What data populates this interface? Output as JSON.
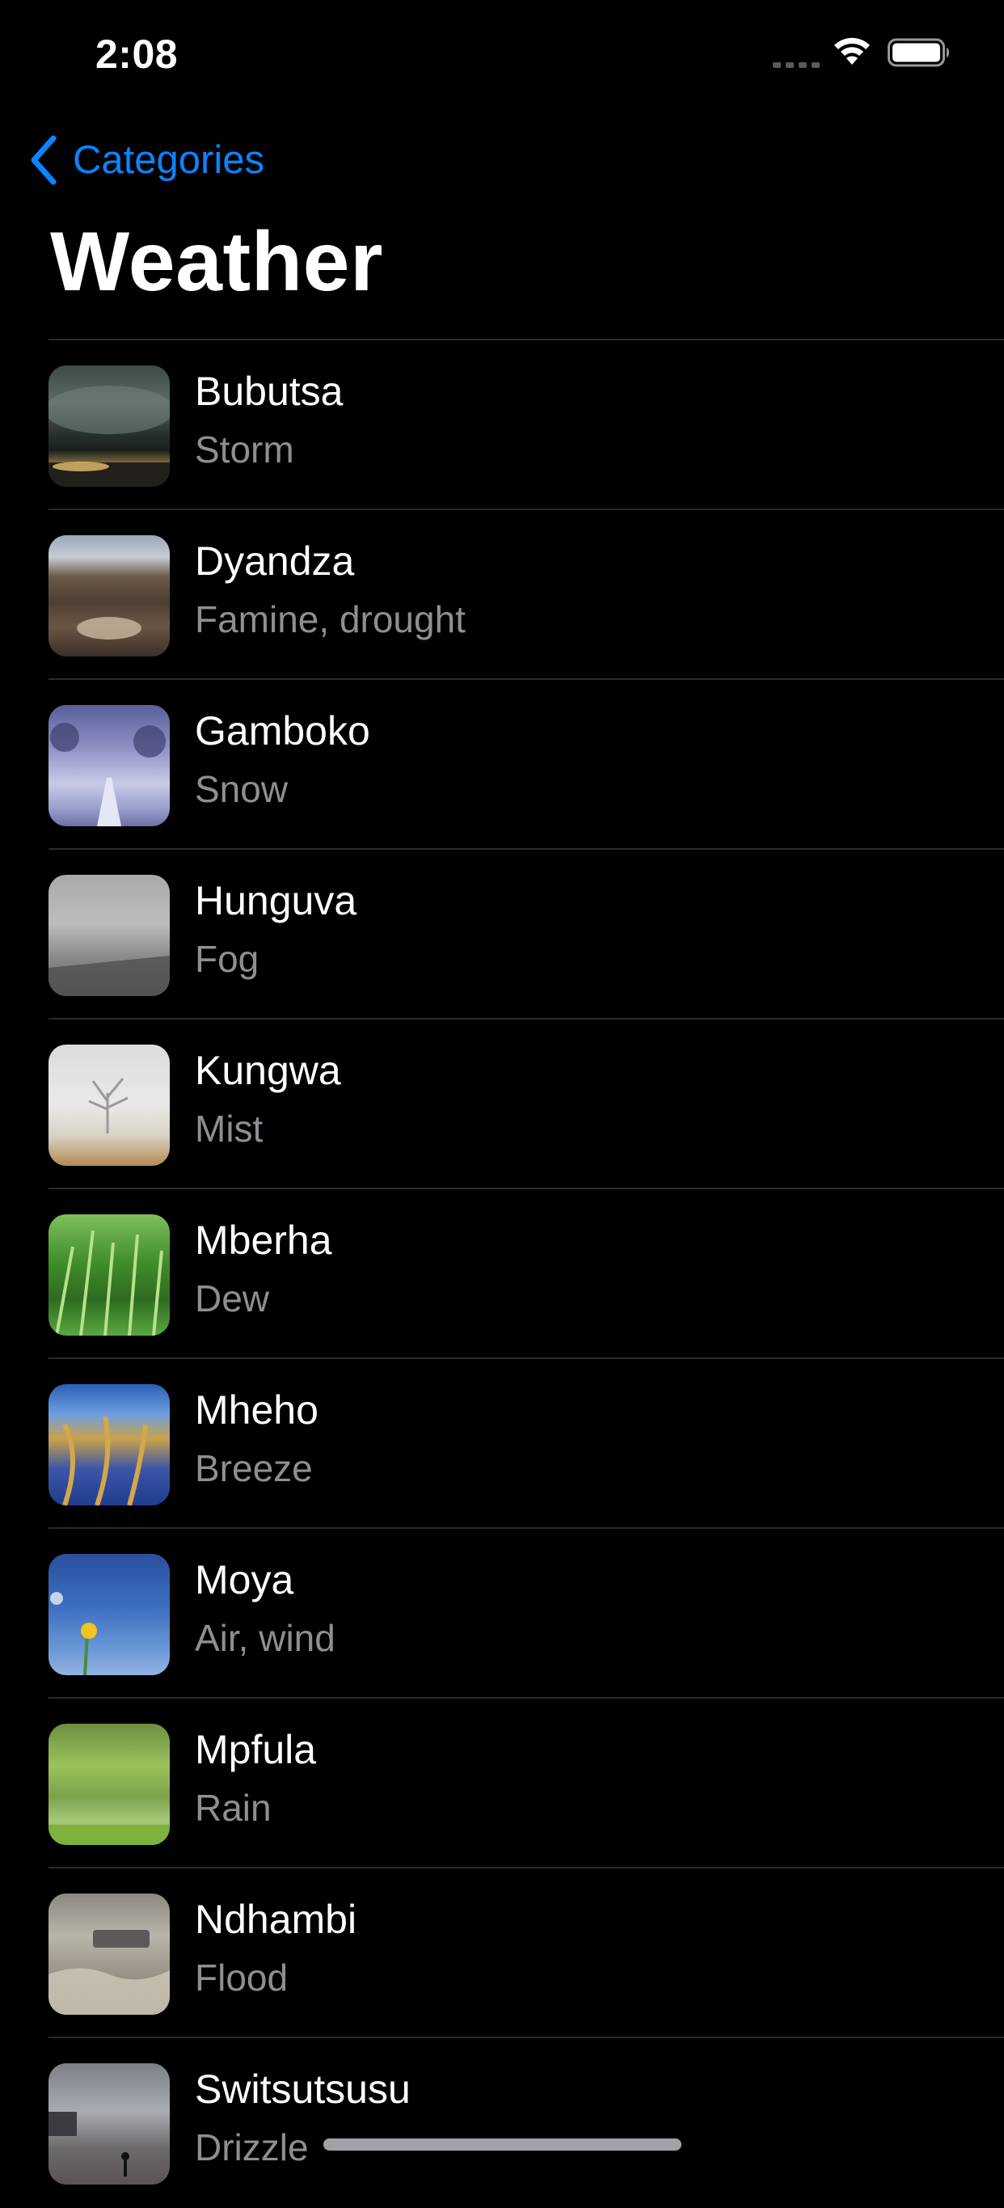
{
  "status_bar": {
    "time": "2:08"
  },
  "nav": {
    "back_label": "Categories",
    "accent_color": "#0a84ff"
  },
  "page": {
    "title": "Weather"
  },
  "items": [
    {
      "title": "Bubutsa",
      "subtitle": "Storm",
      "thumbnail": "storm-image"
    },
    {
      "title": "Dyandza",
      "subtitle": "Famine, drought",
      "thumbnail": "drought-image"
    },
    {
      "title": "Gamboko",
      "subtitle": "Snow",
      "thumbnail": "snow-image"
    },
    {
      "title": "Hunguva",
      "subtitle": "Fog",
      "thumbnail": "fog-image"
    },
    {
      "title": "Kungwa",
      "subtitle": "Mist",
      "thumbnail": "mist-image"
    },
    {
      "title": "Mberha",
      "subtitle": "Dew",
      "thumbnail": "dew-image"
    },
    {
      "title": "Mheho",
      "subtitle": "Breeze",
      "thumbnail": "breeze-image"
    },
    {
      "title": "Moya",
      "subtitle": "Air, wind",
      "thumbnail": "wind-image"
    },
    {
      "title": "Mpfula",
      "subtitle": "Rain",
      "thumbnail": "rain-image"
    },
    {
      "title": "Ndhambi",
      "subtitle": "Flood",
      "thumbnail": "flood-image"
    },
    {
      "title": "Switsutsusu",
      "subtitle": "Drizzle",
      "thumbnail": "drizzle-image"
    }
  ]
}
